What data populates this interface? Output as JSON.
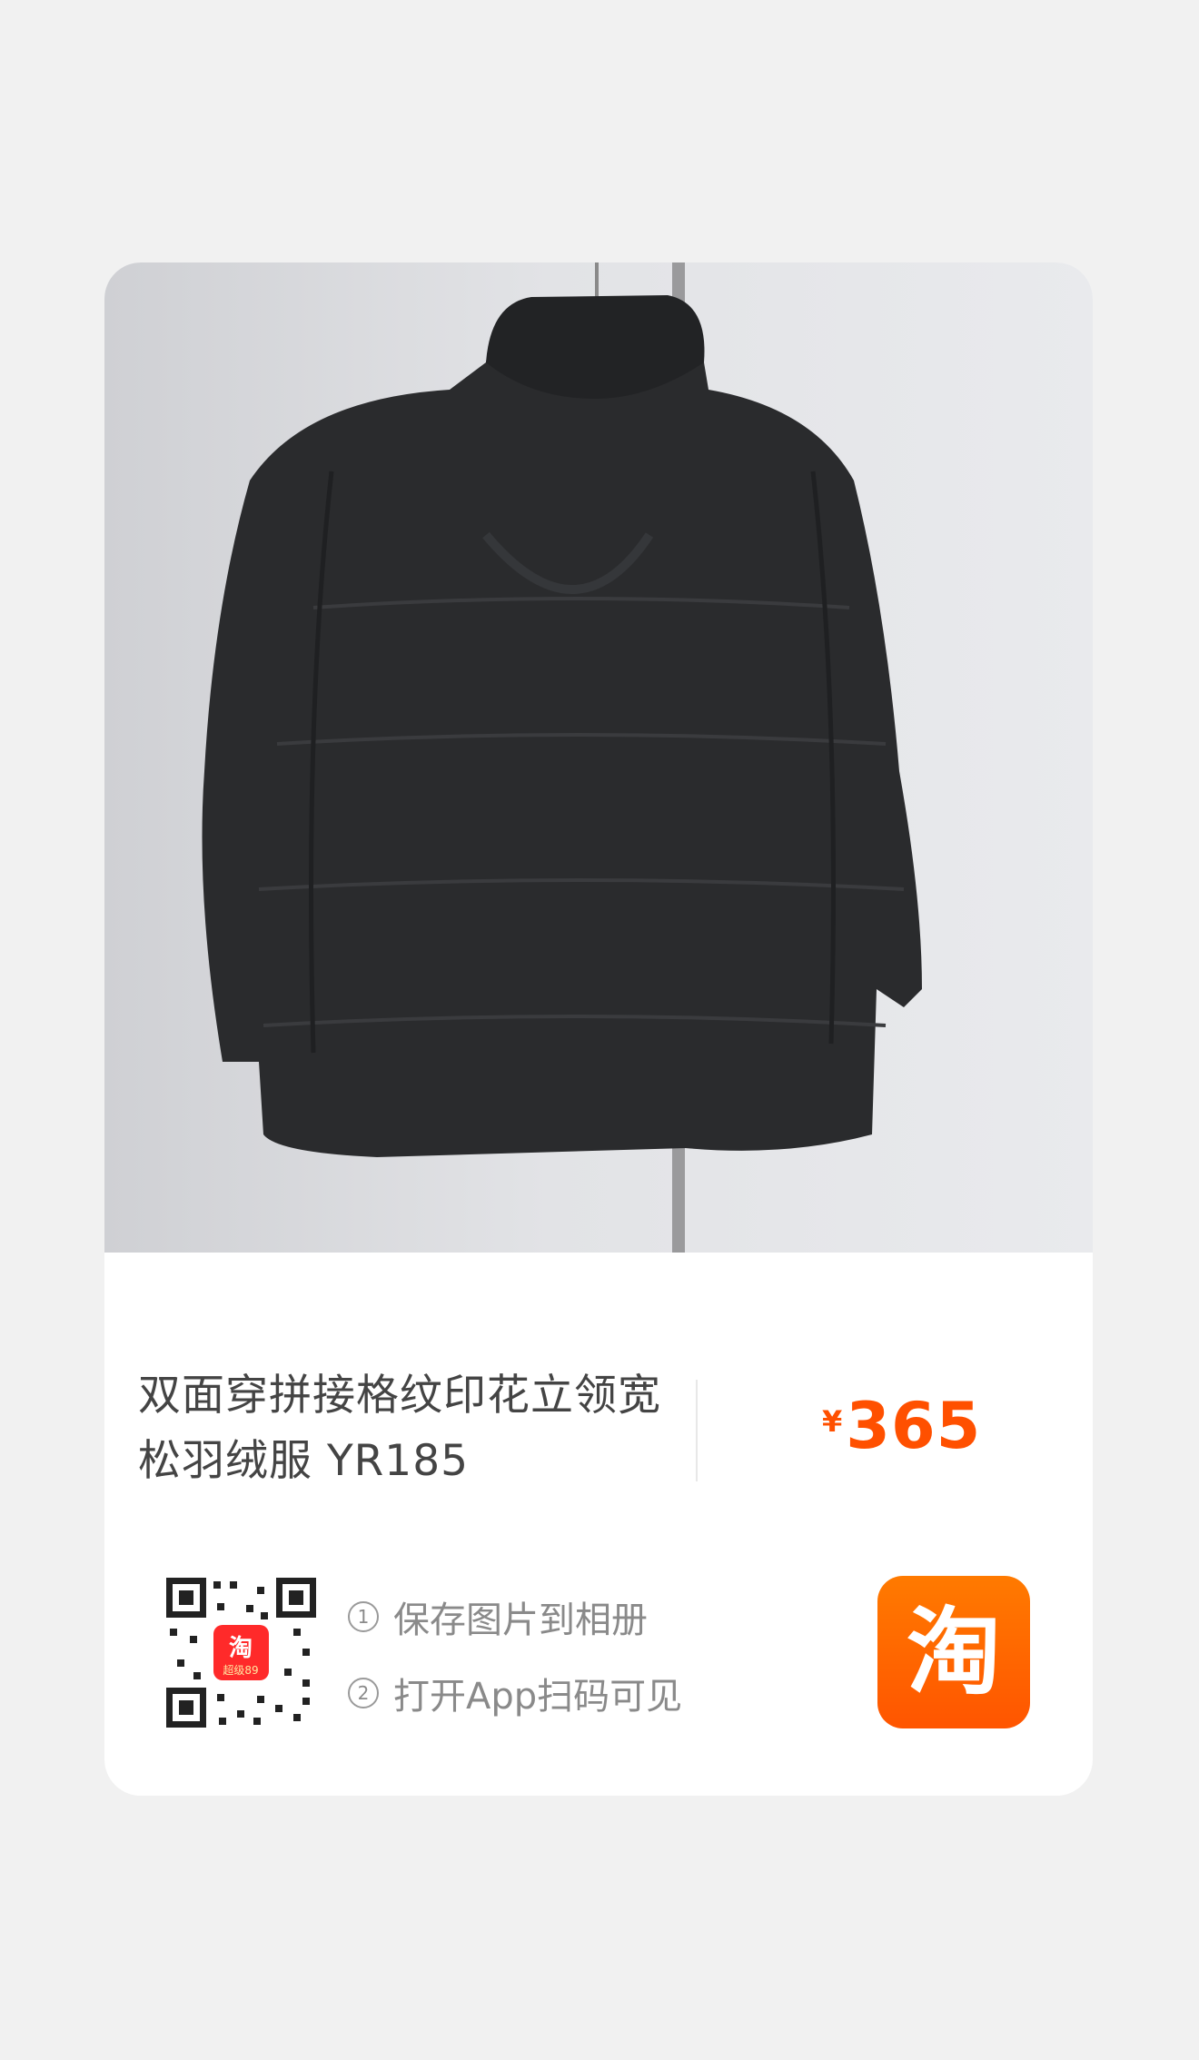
{
  "product": {
    "title": "双面穿拼接格纹印花立领宽松羽绒服 YR185",
    "price_symbol": "¥",
    "price": "365"
  },
  "share": {
    "qr_badge_text": "淘",
    "qr_badge_sub": "超级89",
    "steps": [
      {
        "num": "1",
        "text": "保存图片到相册"
      },
      {
        "num": "2",
        "text": "打开App扫码可见"
      }
    ]
  },
  "app_logo": {
    "text": "淘",
    "color": "#ff5000"
  },
  "icons": {
    "qr": "qr-code-icon",
    "logo": "taobao-logo-icon"
  }
}
